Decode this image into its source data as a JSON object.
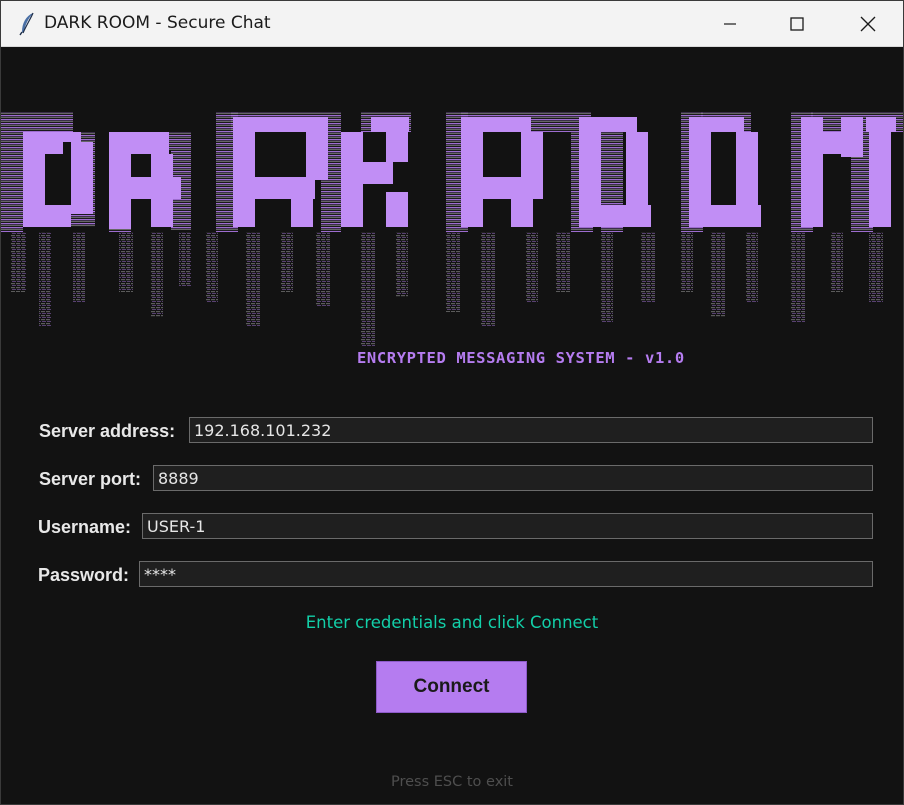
{
  "window": {
    "title": "DARK ROOM - Secure Chat",
    "controls": [
      "minimize-icon",
      "maximize-icon",
      "close-icon"
    ]
  },
  "banner": {
    "logo_text": "DARK ROOM",
    "subtitle": "ENCRYPTED MESSAGING SYSTEM - v1.0"
  },
  "form": {
    "server_address": {
      "label": "Server address:",
      "value": "192.168.101.232"
    },
    "server_port": {
      "label": "Server port:",
      "value": "8889"
    },
    "username": {
      "label": "Username:",
      "value": "USER-1"
    },
    "password": {
      "label": "Password:",
      "value": "****"
    }
  },
  "status": "Enter credentials and click Connect",
  "connect_label": "Connect",
  "hint": "Press ESC to exit",
  "colors": {
    "accent": "#b57cf0",
    "status": "#12cfa8",
    "background": "#121212"
  }
}
